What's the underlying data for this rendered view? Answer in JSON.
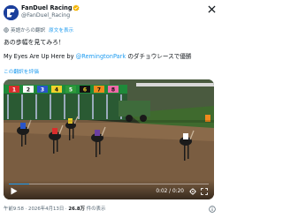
{
  "post": {
    "author_name": "FanDuel Racing",
    "author_handle": "@FanDuel_Racing",
    "translated_from": "英語からの翻訳",
    "show_original": "原文を表示",
    "text_jp": "あの歩幅を見てみろ！",
    "text_en_prefix": "My Eyes Are Up Here by ",
    "mention": "@RemingtonPark",
    "text_en_suffix": " のダチョウレースで優勝",
    "rate_translation": "この翻訳を評価",
    "timestamp": "午前9:58 · 2026年4月13日 · ",
    "views_count": "26.8万",
    "views_label": " 件の表示"
  },
  "video": {
    "current_time": "0:02",
    "duration": "0:20",
    "time_display": "0:02 / 0:20",
    "progress": 0.1,
    "gate_numbers": [
      "1",
      "2",
      "3",
      "4",
      "5",
      "6",
      "7",
      "8"
    ]
  },
  "colors": {
    "accent": "#1d9bf0",
    "verified": "#f4b400",
    "avatar_bg": "#1b3f9c"
  },
  "icons": {
    "avatar": "fanduel-logo",
    "verified": "gold-check-badge",
    "platform": "x-logo",
    "translate": "globe-translate-icon",
    "play": "play-icon",
    "settings": "gear-icon",
    "fullscreen": "fullscreen-icon",
    "info": "info-icon"
  }
}
